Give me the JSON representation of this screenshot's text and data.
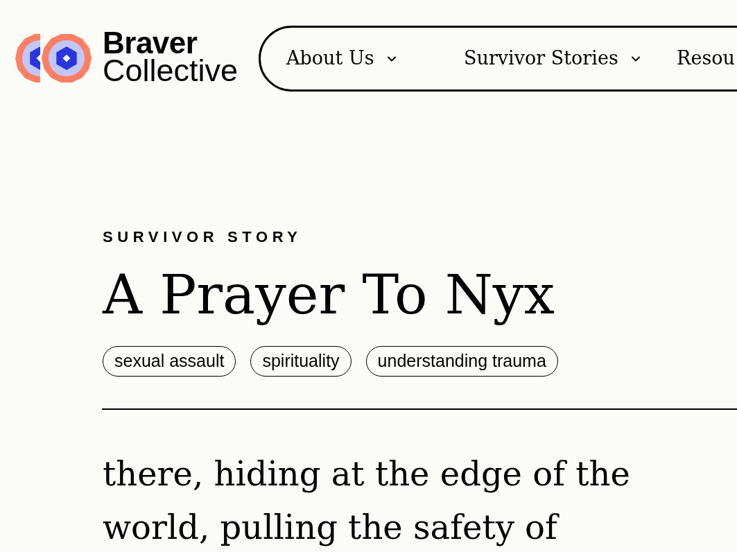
{
  "logo": {
    "line_1": "Braver",
    "line_2": "Collective"
  },
  "nav": {
    "items": [
      {
        "label": "About Us",
        "has_menu": true
      },
      {
        "label": "Survivor Stories",
        "has_menu": true
      },
      {
        "label": "Resou",
        "has_menu": false
      }
    ]
  },
  "article": {
    "category": "SURVIVOR STORY",
    "title": "A Prayer To Nyx",
    "tags": [
      "sexual assault",
      "spirituality",
      "understanding trauma"
    ],
    "body": "there, hiding at the edge of the world, pulling the safety of"
  }
}
